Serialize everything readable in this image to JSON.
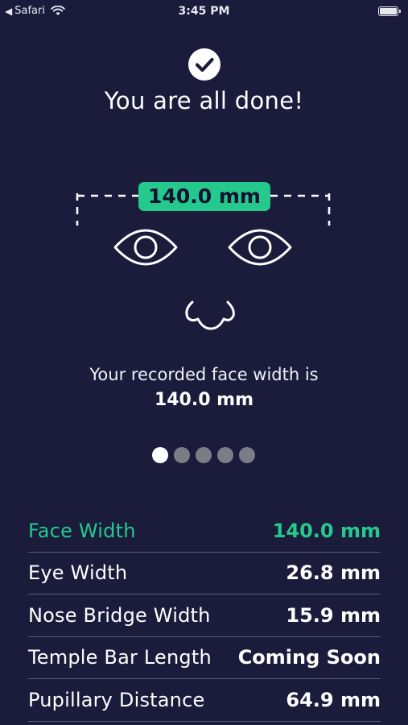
{
  "status_bar": {
    "back_app": "Safari",
    "time": "3:45 PM"
  },
  "header": {
    "title": "You are all done!"
  },
  "illustration": {
    "face_width_pill": "140.0 mm"
  },
  "summary": {
    "line": "Your recorded face width is",
    "value": "140.0 mm"
  },
  "pager": {
    "total": 5,
    "active_index": 0
  },
  "measurements": [
    {
      "label": "Face Width",
      "value": "140.0 mm",
      "highlight": true
    },
    {
      "label": "Eye Width",
      "value": "26.8 mm",
      "highlight": false
    },
    {
      "label": "Nose Bridge Width",
      "value": "15.9 mm",
      "highlight": false
    },
    {
      "label": "Temple Bar Length",
      "value": "Coming Soon",
      "highlight": false
    },
    {
      "label": "Pupillary Distance",
      "value": "64.9 mm",
      "highlight": false
    }
  ],
  "colors": {
    "background": "#1b1c3c",
    "accent": "#25c98e",
    "divider": "#5a5b78",
    "dot_inactive": "#7c7c86"
  }
}
